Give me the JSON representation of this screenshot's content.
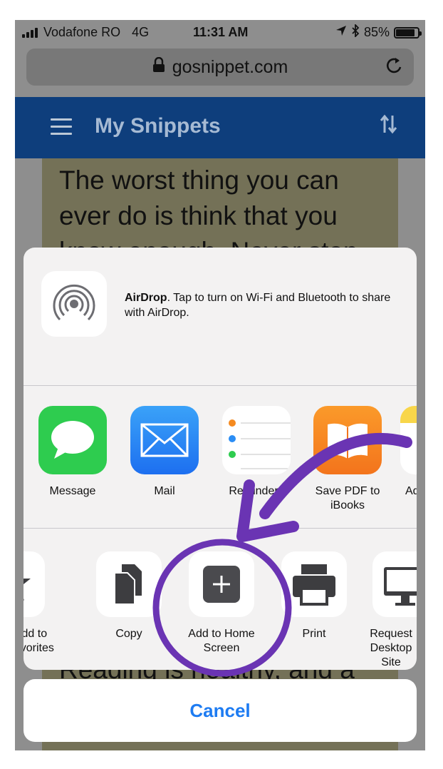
{
  "status_bar": {
    "carrier": "Vodafone RO",
    "network": "4G",
    "time": "11:31 AM",
    "battery": "85%",
    "battery_level": 0.85,
    "icons": [
      "signal-icon",
      "location-icon",
      "bluetooth-icon",
      "battery-icon"
    ]
  },
  "browser": {
    "url": "gosnippet.com",
    "lock_icon": "lock-icon",
    "reload_icon": "reload-icon"
  },
  "app": {
    "title": "My Snippets",
    "menu_icon": "hamburger-icon",
    "sort_icon": "sort-icon",
    "header_color": "#0e3e7c"
  },
  "snippet": {
    "text": "The worst thing you can ever do is think that you know enough. Never stop",
    "text_bottom": "Reading is healthy, and a"
  },
  "share_sheet": {
    "airdrop": {
      "title": "AirDrop",
      "message": ". Tap to turn on Wi-Fi and Bluetooth to share with AirDrop."
    },
    "apps": [
      {
        "label": "Message",
        "icon": "message-icon",
        "color": "#2ecc4f"
      },
      {
        "label": "Mail",
        "icon": "mail-icon",
        "color": "#2a8df5"
      },
      {
        "label": "Reminders",
        "icon": "reminders-icon",
        "color": "#ffffff"
      },
      {
        "label": "Save PDF to iBooks",
        "icon": "ibooks-icon",
        "color": "#f58a1f"
      },
      {
        "label": "Ad",
        "icon": "notes-icon",
        "color": "#f8d64a"
      }
    ],
    "actions": [
      {
        "label": "Add to Favorites",
        "icon": "star-icon"
      },
      {
        "label": "Copy",
        "icon": "copy-icon"
      },
      {
        "label": "Add to Home Screen",
        "icon": "add-icon"
      },
      {
        "label": "Print",
        "icon": "print-icon"
      },
      {
        "label": "Request Desktop Site",
        "icon": "desktop-icon"
      }
    ],
    "cancel": "Cancel",
    "accent_color": "#1e7cf2",
    "annotation_color": "#6a34b3"
  }
}
